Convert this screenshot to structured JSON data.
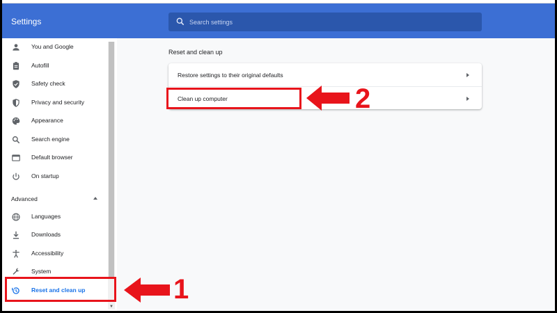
{
  "header": {
    "title": "Settings",
    "search_placeholder": "Search settings"
  },
  "sidebar": {
    "items": [
      {
        "label": "You and Google",
        "icon": "person-icon"
      },
      {
        "label": "Autofill",
        "icon": "clipboard-icon"
      },
      {
        "label": "Safety check",
        "icon": "shield-check-icon"
      },
      {
        "label": "Privacy and security",
        "icon": "shield-icon"
      },
      {
        "label": "Appearance",
        "icon": "palette-icon"
      },
      {
        "label": "Search engine",
        "icon": "search-icon"
      },
      {
        "label": "Default browser",
        "icon": "browser-icon"
      },
      {
        "label": "On startup",
        "icon": "power-icon"
      }
    ],
    "advanced_label": "Advanced",
    "advanced_items": [
      {
        "label": "Languages",
        "icon": "globe-icon"
      },
      {
        "label": "Downloads",
        "icon": "download-icon"
      },
      {
        "label": "Accessibility",
        "icon": "accessibility-icon"
      },
      {
        "label": "System",
        "icon": "wrench-icon"
      },
      {
        "label": "Reset and clean up",
        "icon": "history-icon",
        "active": true
      }
    ]
  },
  "main": {
    "section_title": "Reset and clean up",
    "rows": [
      {
        "label": "Restore settings to their original defaults"
      },
      {
        "label": "Clean up computer"
      }
    ]
  },
  "annotations": {
    "step1": "1",
    "step2": "2",
    "color": "#e8141b"
  },
  "colors": {
    "header_bg": "#3c6fd4",
    "search_bg": "#2b57ac",
    "active": "#1a73e8"
  }
}
